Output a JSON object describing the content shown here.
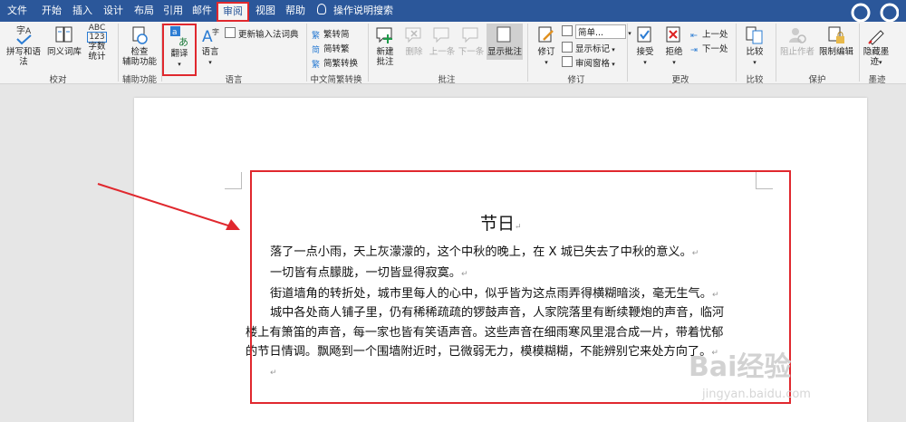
{
  "tabs": [
    "文件",
    "开始",
    "插入",
    "设计",
    "布局",
    "引用",
    "邮件",
    "审阅",
    "视图",
    "帮助",
    "操作说明搜索"
  ],
  "ribbon": {
    "proofing": {
      "spell": "拼写和语法",
      "thesaurus": "同义词库",
      "wordcount_1": "字数",
      "wordcount_2": "统计",
      "group": "校对",
      "abc": "ABC",
      "num": "123"
    },
    "accessibility": {
      "check_1": "检查",
      "check_2": "辅助功能",
      "group": "辅助功能"
    },
    "language": {
      "translate": "翻译",
      "language": "语言",
      "ime": "更新输入法词典",
      "group": "语言"
    },
    "chinese": {
      "t2s": "繁转简",
      "s2t": "简转繁",
      "convert": "简繁转换",
      "group": "中文简繁转换"
    },
    "comments": {
      "new_1": "新建",
      "new_2": "批注",
      "delete": "删除",
      "prev": "上一条",
      "next": "下一条",
      "show": "显示批注",
      "group": "批注"
    },
    "tracking": {
      "track": "修订",
      "simple": "简单...",
      "show_markup": "显示标记",
      "pane": "审阅窗格",
      "group": "修订"
    },
    "changes": {
      "accept": "接受",
      "reject": "拒绝",
      "prev": "上一处",
      "next": "下一处",
      "group": "更改"
    },
    "compare": {
      "compare": "比较",
      "group": "比较"
    },
    "protect": {
      "block": "阻止作者",
      "restrict": "限制编辑",
      "group": "保护"
    },
    "ink": {
      "hide_1": "隐藏墨",
      "hide_2": "迹",
      "group": "墨迹"
    }
  },
  "document": {
    "title": "节日",
    "l1": "落了一点小雨，天上灰濛濛的，这个中秋的晚上，在 X 城已失去了中秋的意义。",
    "l2": "一切皆有点朦胧，一切皆显得寂寞。",
    "l3": "街道墙角的转折处，城市里每人的心中，似乎皆为这点雨弄得横糊暗淡，毫无生气。",
    "l4": "城中各处商人铺子里，仍有稀稀疏疏的锣鼓声音，人家院落里有断续鞭炮的声音，临河",
    "l5": "楼上有箫笛的声音，每一家也皆有笑语声音。这些声音在细雨寒风里混合成一片，带着忧郁",
    "l6": "的节日情调。飘飏到一个围墙附近时，已微弱无力，模模糊糊，不能辨别它来处方向了。"
  },
  "watermark": {
    "brand": "Bai经验",
    "url": "jingyan.baidu.com"
  },
  "colors": {
    "tabbar": "#2b579a",
    "highlight": "#e0282e",
    "ribbon": "#f3f3f3"
  }
}
